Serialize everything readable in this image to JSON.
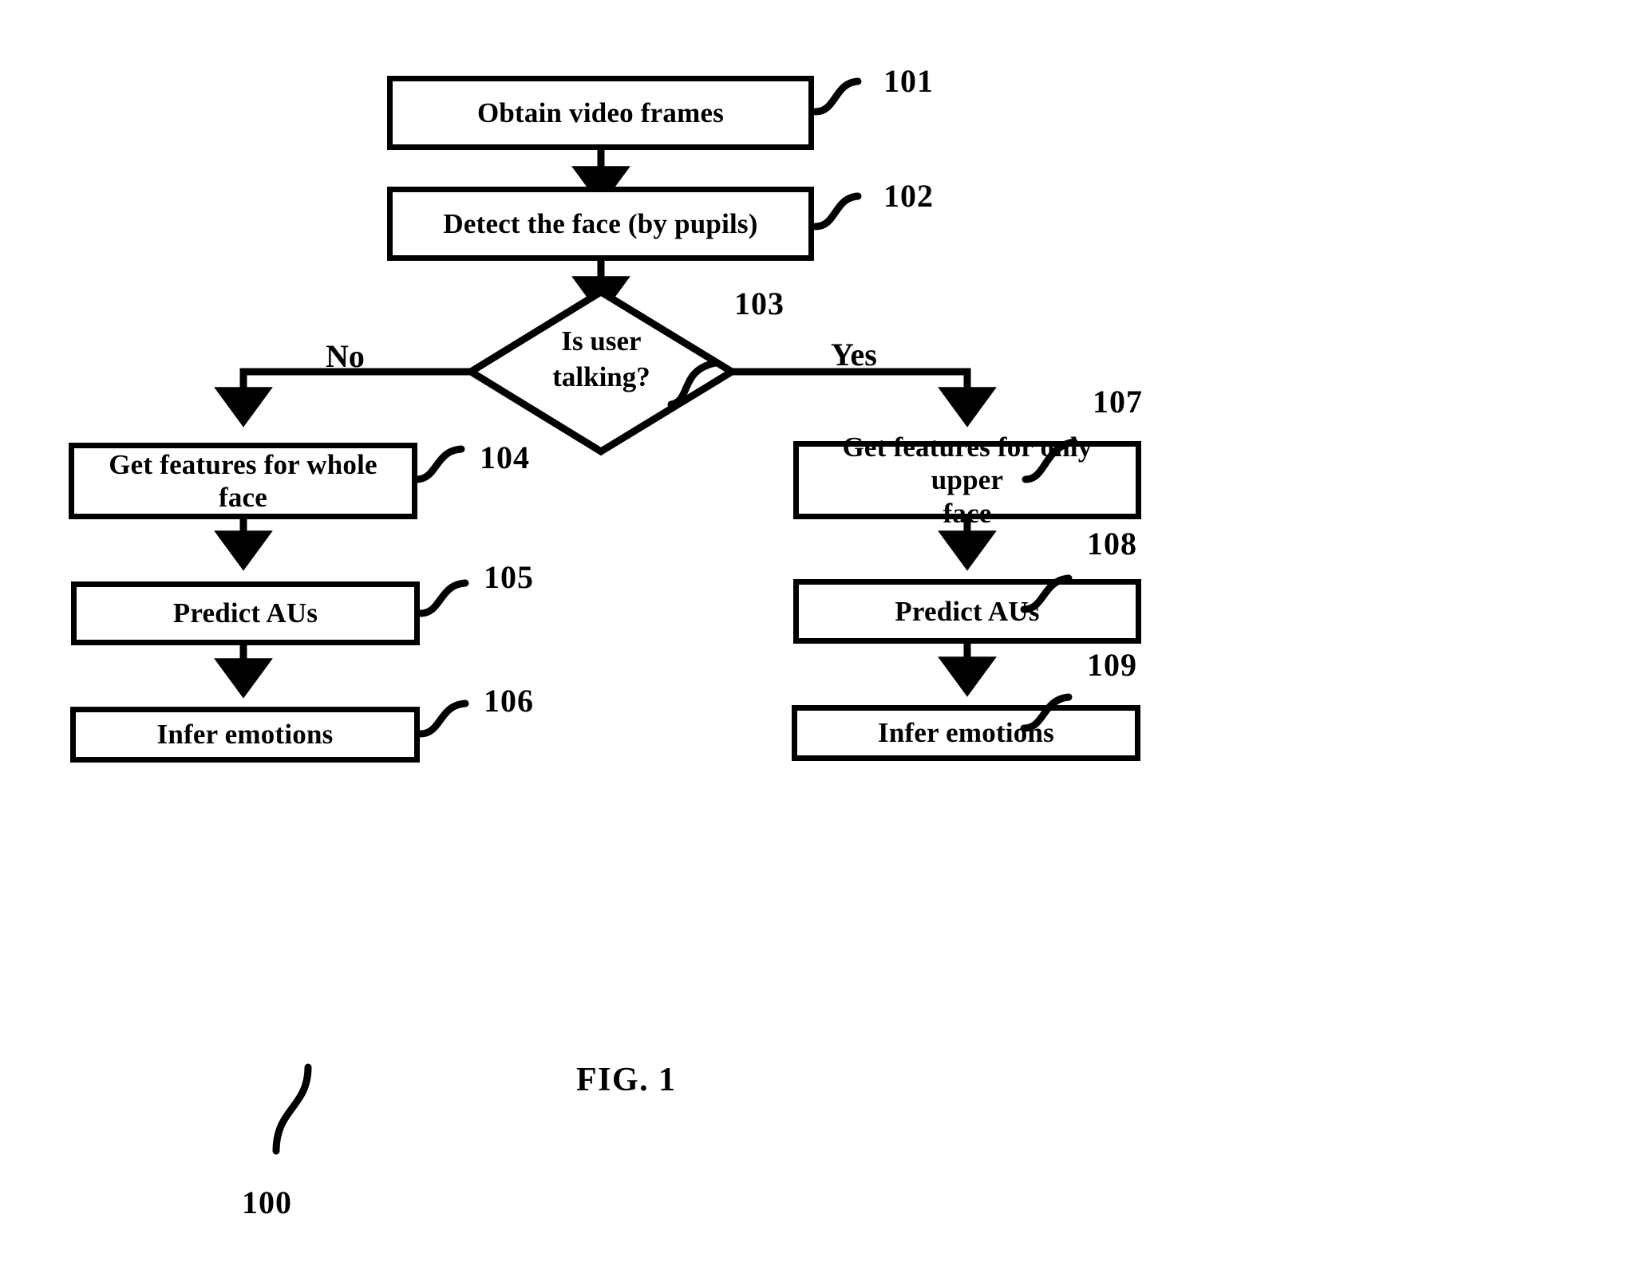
{
  "figure": {
    "caption": "FIG. 1",
    "system_ref": "100"
  },
  "nodes": [
    {
      "id": "101",
      "ref": "101",
      "type": "process",
      "label": "Obtain video frames"
    },
    {
      "id": "102",
      "ref": "102",
      "type": "process",
      "label": "Detect the face (by pupils)"
    },
    {
      "id": "103",
      "ref": "103",
      "type": "decision",
      "label": "Is user\ntalking?"
    },
    {
      "id": "104",
      "ref": "104",
      "type": "process",
      "label": "Get features for whole face"
    },
    {
      "id": "105",
      "ref": "105",
      "type": "process",
      "label": "Predict AUs"
    },
    {
      "id": "106",
      "ref": "106",
      "type": "process",
      "label": "Infer emotions"
    },
    {
      "id": "107",
      "ref": "107",
      "type": "process",
      "label": "Get features for only upper\nface"
    },
    {
      "id": "108",
      "ref": "108",
      "type": "process",
      "label": "Predict AUs"
    },
    {
      "id": "109",
      "ref": "109",
      "type": "process",
      "label": "Infer emotions"
    }
  ],
  "branches": {
    "no_label": "No",
    "yes_label": "Yes"
  },
  "colors": {
    "stroke": "#000000",
    "fill": "#ffffff"
  }
}
